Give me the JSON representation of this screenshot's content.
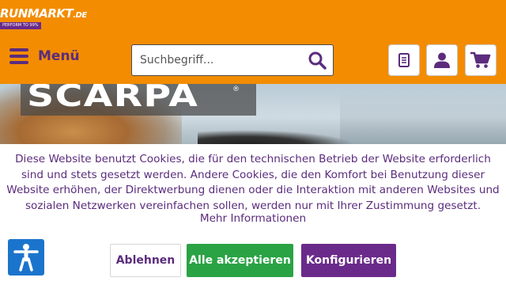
{
  "header": {
    "logo_main": "RUNMARKT",
    "logo_tld": ".DE",
    "logo_tagline": "PERFORM TO 99%",
    "menu_label": "Menü",
    "search_placeholder": "Suchbegriff...",
    "icons": [
      "notes-icon",
      "user-icon",
      "cart-icon",
      "search-icon",
      "hamburger-icon"
    ]
  },
  "hero": {
    "brand": "SCARPA",
    "brand_mark": "®"
  },
  "cookie": {
    "text": "Diese Website benutzt Cookies, die für den technischen Betrieb der Website erforderlich sind und stets gesetzt werden. Andere Cookies, die den Komfort bei Benutzung dieser Website erhöhen, der Direktwerbung dienen oder die Interaktion mit anderen Websites und sozialen Netzwerken vereinfachen sollen, werden nur mit Ihrer Zustimmung gesetzt.",
    "more_link": "Mehr Informationen",
    "reject_label": "Ablehnen",
    "accept_label": "Alle akzeptieren",
    "configure_label": "Konfigurieren"
  },
  "colors": {
    "header_bg": "#f38c00",
    "brand_purple": "#5b2c7d",
    "accept_green": "#2aa344",
    "configure_purple": "#6a2a8a",
    "accessibility_blue": "#1b74cc"
  }
}
